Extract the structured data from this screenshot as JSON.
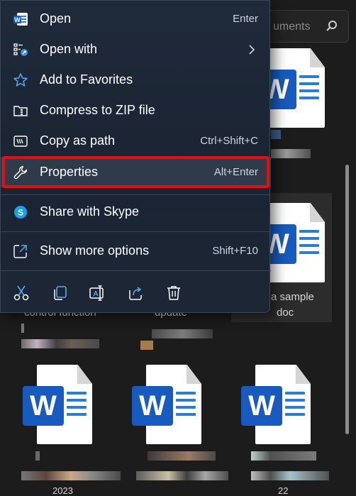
{
  "menu": {
    "items": [
      {
        "label": "Open",
        "shortcut": "Enter",
        "icon": "word-icon"
      },
      {
        "label": "Open with",
        "shortcut": "",
        "icon": "open-with-icon"
      },
      {
        "label": "Add to Favorites",
        "shortcut": "",
        "icon": "star-icon"
      },
      {
        "label": "Compress to ZIP file",
        "shortcut": "",
        "icon": "zip-folder-icon"
      },
      {
        "label": "Copy as path",
        "shortcut": "Ctrl+Shift+C",
        "icon": "copy-path-icon"
      },
      {
        "label": "Properties",
        "shortcut": "Alt+Enter",
        "icon": "wrench-icon"
      },
      {
        "label": "Share with Skype",
        "shortcut": "",
        "icon": "skype-icon"
      },
      {
        "label": "Show more options",
        "shortcut": "Shift+F10",
        "icon": "more-options-icon"
      }
    ],
    "actions": [
      "cut-icon",
      "copy-icon",
      "rename-icon",
      "share-icon",
      "delete-icon"
    ]
  },
  "explorer": {
    "search_placeholder": "uments",
    "files": [
      {
        "label_line1": "a sample",
        "label_line2": "doc"
      },
      {
        "label_line1": "control function",
        "label_line2": ""
      },
      {
        "label_line1": "update",
        "label_line2": ""
      },
      {
        "label_line1": "2023",
        "label_line2": ""
      },
      {
        "label_line1": "22",
        "label_line2": ""
      }
    ]
  },
  "colors": {
    "menu_bg": "#1d2838",
    "highlight_border": "#e01010",
    "word_blue": "#185abd"
  }
}
